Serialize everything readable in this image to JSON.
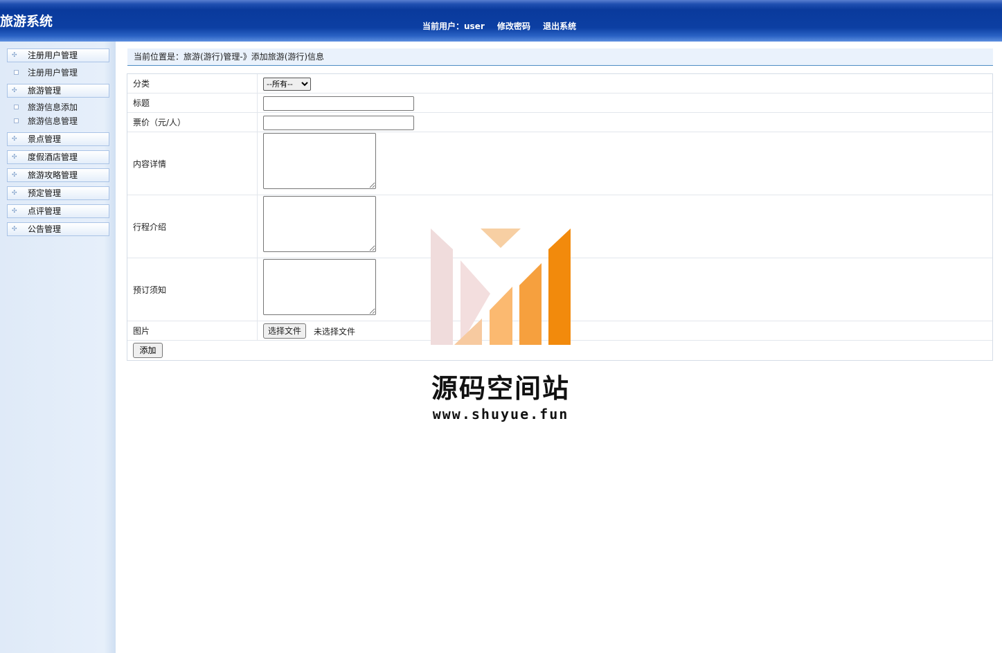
{
  "header": {
    "title": "旅游系统",
    "current_user_label": "当前用户：user",
    "change_password": "修改密码",
    "logout": "退出系统"
  },
  "sidebar": {
    "groups": [
      {
        "label": "注册用户管理",
        "items": [
          "注册用户管理"
        ]
      },
      {
        "label": "旅游管理",
        "items": [
          "旅游信息添加",
          "旅游信息管理"
        ]
      },
      {
        "label": "景点管理",
        "items": []
      },
      {
        "label": "度假酒店管理",
        "items": []
      },
      {
        "label": "旅游攻略管理",
        "items": []
      },
      {
        "label": "预定管理",
        "items": []
      },
      {
        "label": "点评管理",
        "items": []
      },
      {
        "label": "公告管理",
        "items": []
      }
    ]
  },
  "breadcrumb": "当前位置是：旅游(游行)管理-》添加旅游(游行)信息",
  "form": {
    "category_label": "分类",
    "category_selected": "--所有--",
    "title_label": "标题",
    "title_value": "",
    "price_label": "票价（元/人）",
    "price_value": "",
    "content_label": "内容详情",
    "itinerary_label": "行程介绍",
    "notice_label": "预订须知",
    "image_label": "图片",
    "file_button": "选择文件",
    "file_status": "未选择文件",
    "submit": "添加"
  },
  "watermark": {
    "title": "源码空间站",
    "url": "www.shuyue.fun",
    "colors": [
      "#f0d8d8",
      "#f7c79a",
      "#f5a345",
      "#f28a0c"
    ]
  }
}
